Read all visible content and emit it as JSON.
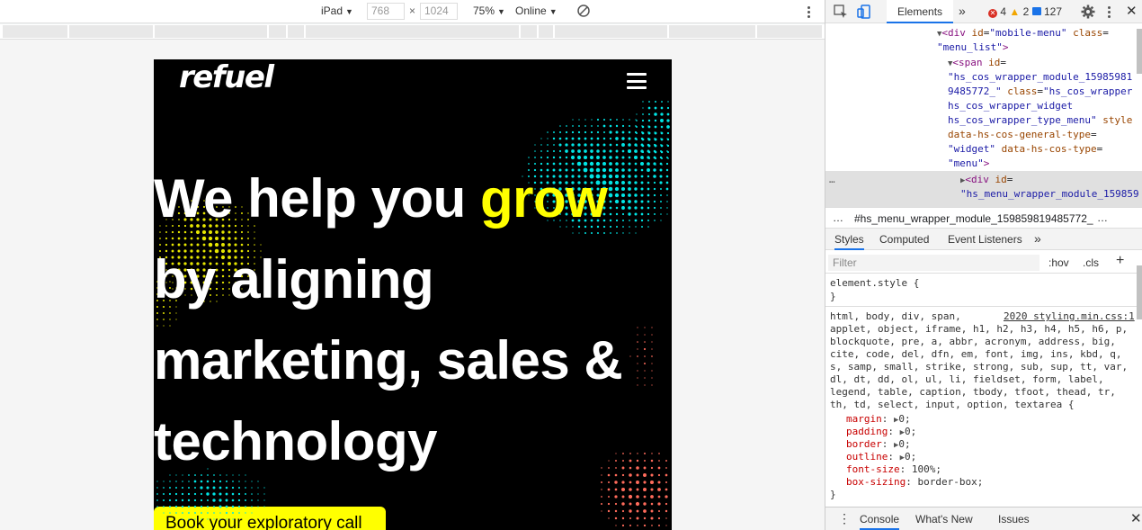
{
  "device_toolbar": {
    "device": "iPad",
    "width": "768",
    "height": "1024",
    "zoom": "75%",
    "network": "Online",
    "times_sign": "×"
  },
  "page": {
    "logo": "refuel",
    "headline": {
      "line1_a": "We help you ",
      "line1_b": "grow",
      "line2": "by aligning",
      "line3": "marketing, sales &",
      "line4": "technology"
    },
    "cta_label": "Book your exploratory call",
    "colors": {
      "accent": "#ffff00",
      "dots_cyan": "#00e5e5",
      "dots_yellow": "#e6e600",
      "dots_red": "#ff6b5b"
    }
  },
  "devtools": {
    "tab_elements": "Elements",
    "more_tabs": "»",
    "errors": "4",
    "warnings": "2",
    "messages": "127",
    "dom": {
      "l1_tag": "div",
      "l1_attr1": "id",
      "l1_val1": "\"mobile-menu\"",
      "l1_attr2": "class",
      "l1_val2": "\"menu_list\"",
      "l2_tag": "span",
      "l2_attr1": "id",
      "l2_val1a": "\"hs_cos_wrapper_module_15985981",
      "l2_val1b": "9485772_\"",
      "l2_attr2": "class",
      "l2_val2a": "\"hs_cos_wrapper",
      "l2_val2b": "hs_cos_wrapper_widget",
      "l2_val2c": "hs_cos_wrapper_type_menu\"",
      "l2_attr3": "style",
      "l2_attr4": "data-hs-cos-general-type",
      "l2_val4": "\"widget\"",
      "l2_attr5": "data-hs-cos-type",
      "l2_val5": "\"menu\"",
      "l3_tag": "div",
      "l3_attr1": "id",
      "l3_val1": "\"hs_menu_wrapper_module_159859"
    },
    "breadcrumb": "#hs_menu_wrapper_module_159859819485772_",
    "styles_tabs": [
      "Styles",
      "Computed",
      "Event Listeners"
    ],
    "filter_placeholder": "Filter",
    "hov": ":hov",
    "cls": ".cls",
    "element_style": "element.style {",
    "close_brace": "}",
    "rule_source": "2020 styling.min.css:1",
    "selectors": [
      "html, body, div, span,",
      "applet, object, iframe, h1, h2, h3, h4, h5, h6, p,",
      "blockquote, pre, a, abbr, acronym, address, big,",
      "cite, code, del, dfn, em, font, img, ins, kbd, q,",
      "s, samp, small, strike, strong, sub, sup, tt, var,",
      "dl, dt, dd, ol, ul, li, fieldset, form, label,",
      "legend, table, caption, tbody, tfoot, thead, tr,",
      "th, td, select, input, option, textarea {"
    ],
    "declarations": [
      {
        "prop": "margin",
        "value": "0;"
      },
      {
        "prop": "padding",
        "value": "0;"
      },
      {
        "prop": "border",
        "value": "0;"
      },
      {
        "prop": "outline",
        "value": "0;"
      },
      {
        "prop": "font-size",
        "value": "100%;"
      },
      {
        "prop": "box-sizing",
        "value": "border-box;"
      }
    ],
    "console_tabs": [
      "Console",
      "What's New",
      "Issues"
    ]
  }
}
